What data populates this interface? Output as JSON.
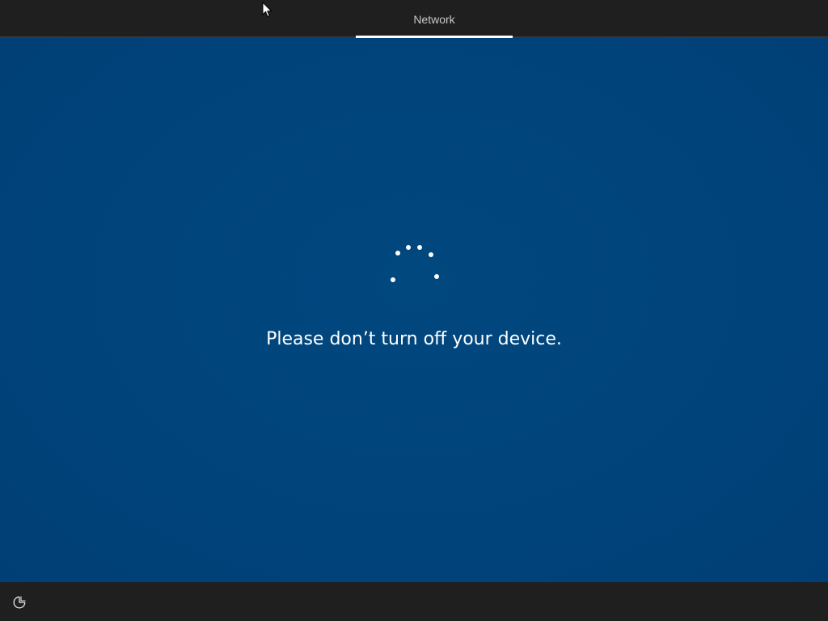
{
  "header": {
    "step_label": "Network"
  },
  "main": {
    "message": "Please don’t turn off your device."
  },
  "footer": {
    "accessibility_icon": "ease-of-access-icon"
  },
  "colors": {
    "background": "#00457c",
    "bars": "#1f1f1f",
    "text": "#ffffff"
  }
}
